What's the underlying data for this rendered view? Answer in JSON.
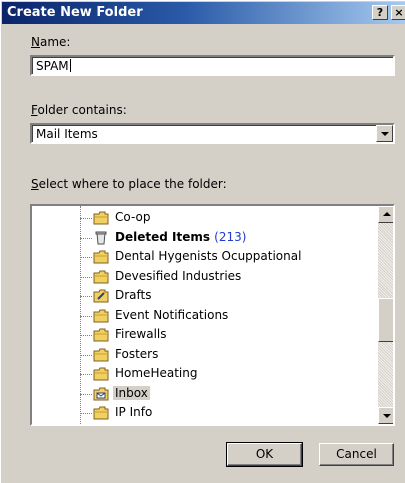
{
  "window": {
    "title": "Create New Folder",
    "help_label": "?",
    "close_label": "×"
  },
  "name_field": {
    "label_mnemonic": "N",
    "label_rest": "ame:",
    "value": "SPAM"
  },
  "folder_contains": {
    "label_mnemonic": "F",
    "label_rest": "older contains:",
    "value": "Mail Items"
  },
  "place_label": {
    "mnemonic": "S",
    "rest": "elect where to place the folder:"
  },
  "tree": {
    "items": [
      {
        "label": "Co-op",
        "count": "",
        "bold": false,
        "icon": "folder-icon"
      },
      {
        "label": "Deleted Items",
        "count": "(213)",
        "bold": true,
        "icon": "deleted-items-icon"
      },
      {
        "label": "Dental Hygenists Ocuppational",
        "count": "",
        "bold": false,
        "icon": "folder-icon"
      },
      {
        "label": "Devesified Industries",
        "count": "",
        "bold": false,
        "icon": "folder-icon"
      },
      {
        "label": "Drafts",
        "count": "",
        "bold": false,
        "icon": "drafts-icon"
      },
      {
        "label": "Event Notifications",
        "count": "",
        "bold": false,
        "icon": "folder-icon"
      },
      {
        "label": "Firewalls",
        "count": "",
        "bold": false,
        "icon": "folder-icon"
      },
      {
        "label": "Fosters",
        "count": "",
        "bold": false,
        "icon": "folder-icon"
      },
      {
        "label": "HomeHeating",
        "count": "",
        "bold": false,
        "icon": "folder-icon"
      },
      {
        "label": "Inbox",
        "count": "",
        "bold": false,
        "icon": "inbox-icon",
        "selected": true
      },
      {
        "label": "IP Info",
        "count": "",
        "bold": false,
        "icon": "folder-icon"
      }
    ]
  },
  "buttons": {
    "ok_label": "OK",
    "cancel_label": "Cancel"
  },
  "colors": {
    "title_start": "#0a246a",
    "title_end": "#a6caf0",
    "dialog_face": "#d4d0c8",
    "count_text": "#1f3bd0"
  }
}
